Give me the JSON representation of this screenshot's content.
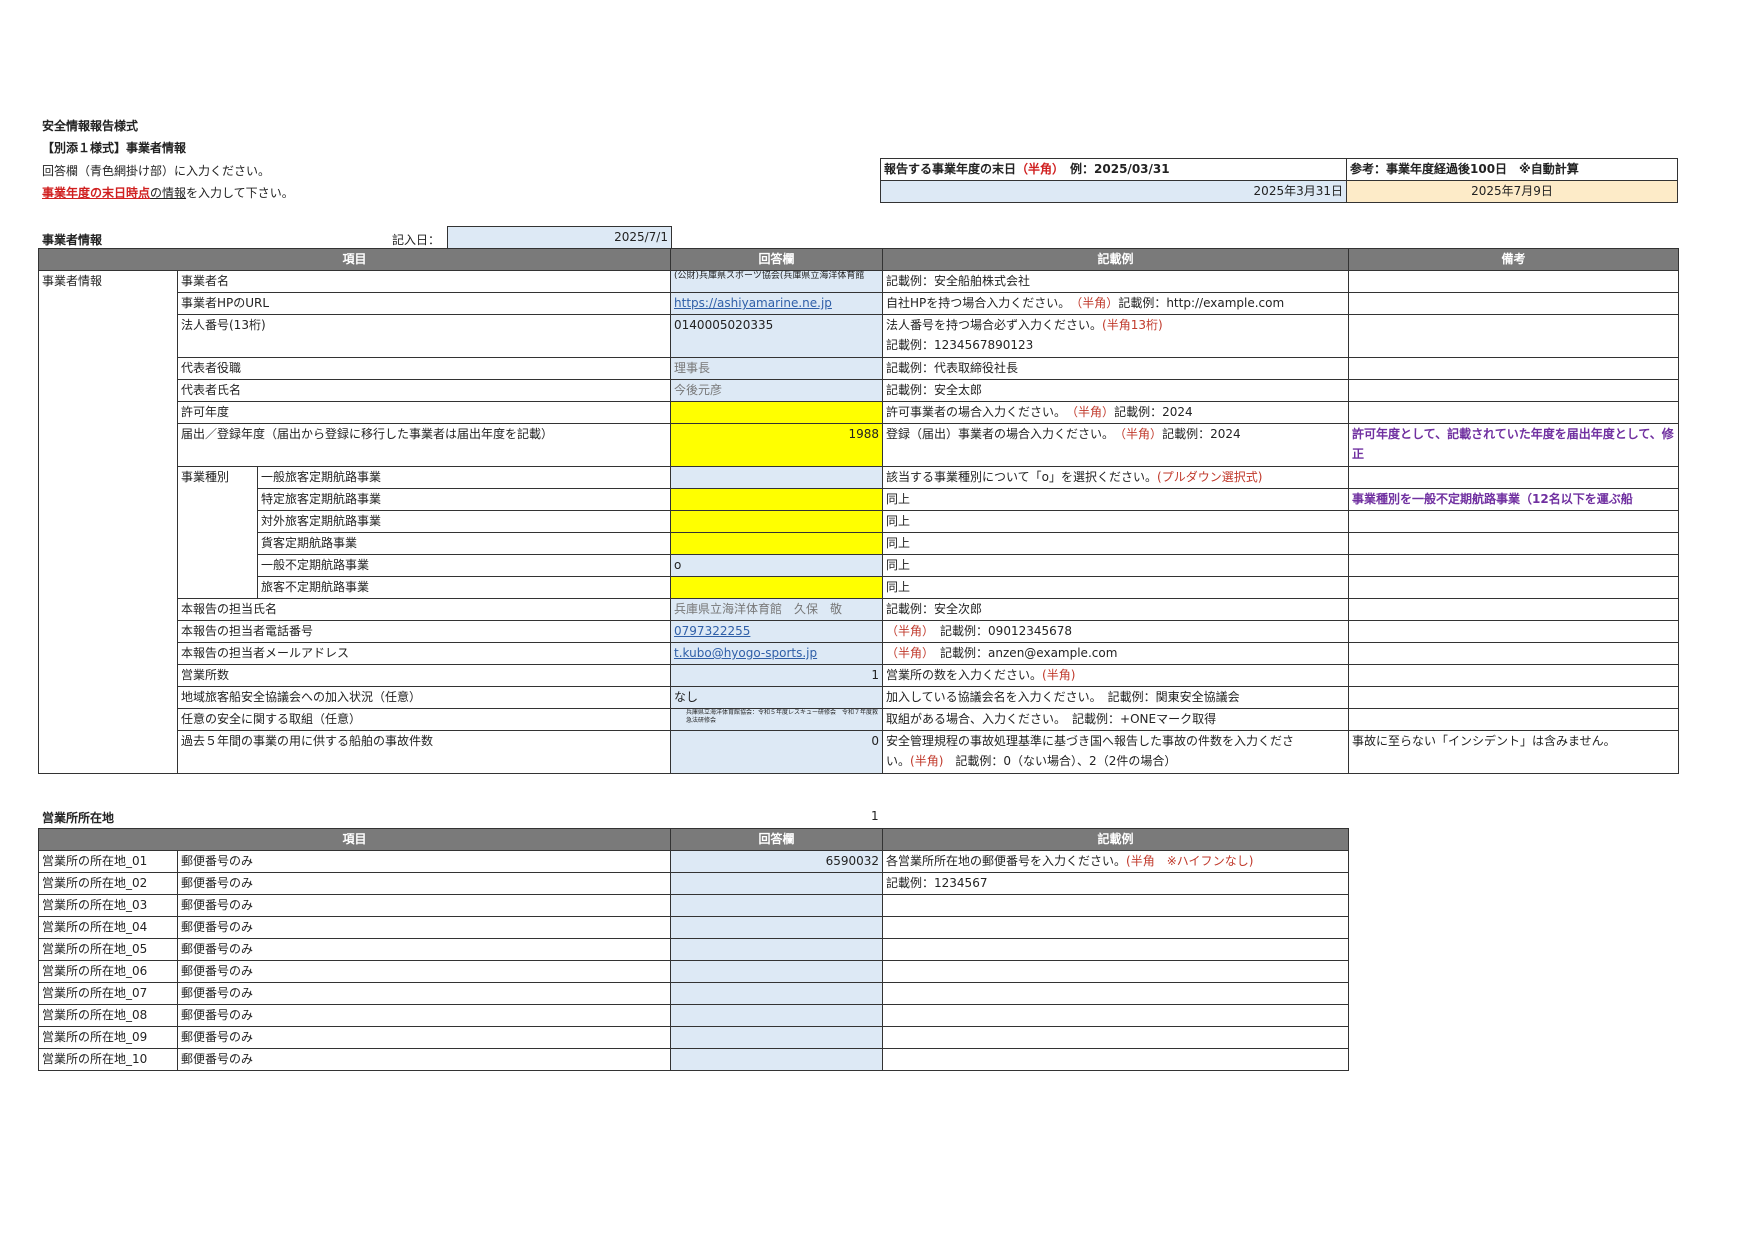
{
  "header": {
    "form_title": "安全情報報告様式",
    "sub_title": "【別添１様式】事業者情報",
    "instruction1": "回答欄（青色網掛け部）に入力ください。",
    "instruction2_red": "事業年度の末日時点",
    "instruction2_mid": "の",
    "instruction2_und": "情報",
    "instruction2_tail": "を入力して下さい。"
  },
  "fiscal": {
    "label_main": "報告する事業年度の末日",
    "label_red": "（半角）",
    "label_example": "　例：2025/03/31",
    "value": "2025年3月31日",
    "ref_label": "参考：事業年度経過後100日　※自動計算",
    "ref_value": "2025年7月9日"
  },
  "section1": {
    "title": "事業者情報",
    "entry_date_label": "記入日：",
    "entry_date": "2025/7/1",
    "headers": {
      "item": "項目",
      "answer": "回答欄",
      "example": "記載例",
      "remarks": "備考"
    },
    "group_label": "事業者情報",
    "biz_type_label": "事業種別",
    "rows": [
      {
        "item": "事業者名",
        "answer": "(公財)兵庫県スポーツ協会(兵庫県立海洋体育館",
        "example": "記載例：安全船舶株式会社",
        "remarks": ""
      },
      {
        "item": "事業者HPのURL",
        "answer": "https://ashiyamarine.ne.jp",
        "example_pre": "自社HPを持つ場合入力ください。　",
        "example_red": "（半角）",
        "example_post": "記載例：http://example.com",
        "remarks": ""
      },
      {
        "item": "法人番号(13桁)",
        "answer": "0140005020335",
        "example_pre": "法人番号を持つ場合必ず入力ください。",
        "example_red": "(半角13桁)",
        "example_line2": "記載例：1234567890123",
        "remarks": ""
      },
      {
        "item": "代表者役職",
        "answer": "理事長",
        "example": "記載例：代表取締役社長",
        "remarks": ""
      },
      {
        "item": "代表者氏名",
        "answer": "今後元彦",
        "example": "記載例：安全太郎",
        "remarks": ""
      },
      {
        "item": "許可年度",
        "answer": "",
        "example_pre": "許可事業者の場合入力ください。　",
        "example_red": "（半角）",
        "example_post": "記載例：2024",
        "remarks": ""
      },
      {
        "item": "届出／登録年度（届出から登録に移行した事業者は届出年度を記載）",
        "answer": "1988",
        "example_pre": "登録（届出）事業者の場合入力ください。　",
        "example_red": "（半角）",
        "example_post": "記載例：2024",
        "remarks": "許可年度として、記載されていた年度を届出年度として、修正"
      }
    ],
    "biz_types": [
      {
        "item": "一般旅客定期航路事業",
        "answer": "",
        "example_pre": "該当する事業種別について「o」を選択ください。",
        "example_red": "(プルダウン選択式)",
        "remarks": ""
      },
      {
        "item": "特定旅客定期航路事業",
        "answer": "",
        "example": "同上",
        "remarks": "事業種別を一般不定期航路事業（12名以下を運ぶ船"
      },
      {
        "item": "対外旅客定期航路事業",
        "answer": "",
        "example": "同上",
        "remarks": ""
      },
      {
        "item": "貨客定期航路事業",
        "answer": "",
        "example": "同上",
        "remarks": ""
      },
      {
        "item": "一般不定期航路事業",
        "answer": "o",
        "example": "同上",
        "remarks": ""
      },
      {
        "item": "旅客不定期航路事業",
        "answer": "",
        "example": "同上",
        "remarks": ""
      }
    ],
    "rows2": [
      {
        "item": "本報告の担当氏名",
        "answer": "兵庫県立海洋体育館　久保　敬",
        "example": "記載例：安全次郎",
        "remarks": ""
      },
      {
        "item": "本報告の担当者電話番号",
        "answer": "0797322255",
        "example_red": "（半角）",
        "example_post": "　記載例：09012345678",
        "remarks": ""
      },
      {
        "item": "本報告の担当者メールアドレス",
        "answer": "t.kubo@hyogo-sports.jp",
        "example_red": "（半角）",
        "example_post": "　記載例：anzen@example.com",
        "remarks": ""
      },
      {
        "item": "営業所数",
        "answer": "1",
        "example_pre": "営業所の数を入力ください。",
        "example_red": "(半角)",
        "remarks": ""
      },
      {
        "item": "地域旅客船安全協議会への加入状況（任意）",
        "answer": "なし",
        "example": "加入している協議会名を入力ください。　記載例：関東安全協議会",
        "remarks": ""
      },
      {
        "item": "任意の安全に関する取組（任意）",
        "answer": "兵庫県立海洋体育館協会：令和５年度レスキュー研修会　令和７年度救急法研修会",
        "example": "取組がある場合、入力ください。　記載例：+ONEマーク取得",
        "remarks": ""
      },
      {
        "item": "過去５年間の事業の用に供する船舶の事故件数",
        "answer": "0",
        "example_pre": "安全管理規程の事故処理基準に基づき国へ報告した事故の件数を入力くださ",
        "example_line2_pre": "い。",
        "example_red": "(半角)",
        "example_line2_post": "　記載例：0（ない場合）、2（2件の場合）",
        "remarks": "事故に至らない「インシデント」は含みません。"
      }
    ]
  },
  "section2": {
    "title": "営業所所在地",
    "count": "1",
    "headers": {
      "item": "項目",
      "answer": "回答欄",
      "example": "記載例"
    },
    "rows": [
      {
        "name": "営業所の所在地_01",
        "sub": "郵便番号のみ",
        "answer": "6590032",
        "example_pre": "各営業所所在地の郵便番号を入力ください。",
        "example_red": "(半角　※ハイフンなし)"
      },
      {
        "name": "営業所の所在地_02",
        "sub": "郵便番号のみ",
        "answer": "",
        "example": "記載例：1234567"
      },
      {
        "name": "営業所の所在地_03",
        "sub": "郵便番号のみ",
        "answer": "",
        "example": ""
      },
      {
        "name": "営業所の所在地_04",
        "sub": "郵便番号のみ",
        "answer": "",
        "example": ""
      },
      {
        "name": "営業所の所在地_05",
        "sub": "郵便番号のみ",
        "answer": "",
        "example": ""
      },
      {
        "name": "営業所の所在地_06",
        "sub": "郵便番号のみ",
        "answer": "",
        "example": ""
      },
      {
        "name": "営業所の所在地_07",
        "sub": "郵便番号のみ",
        "answer": "",
        "example": ""
      },
      {
        "name": "営業所の所在地_08",
        "sub": "郵便番号のみ",
        "answer": "",
        "example": ""
      },
      {
        "name": "営業所の所在地_09",
        "sub": "郵便番号のみ",
        "answer": "",
        "example": ""
      },
      {
        "name": "営業所の所在地_10",
        "sub": "郵便番号のみ",
        "answer": "",
        "example": ""
      }
    ]
  },
  "colors": {
    "header_bg": "#7a7a7a",
    "answer_bg": "#dde9f5",
    "highlight": "#ffff00",
    "ref_bg": "#fdebc8",
    "red": "#d02020",
    "purple": "#7030a0"
  }
}
